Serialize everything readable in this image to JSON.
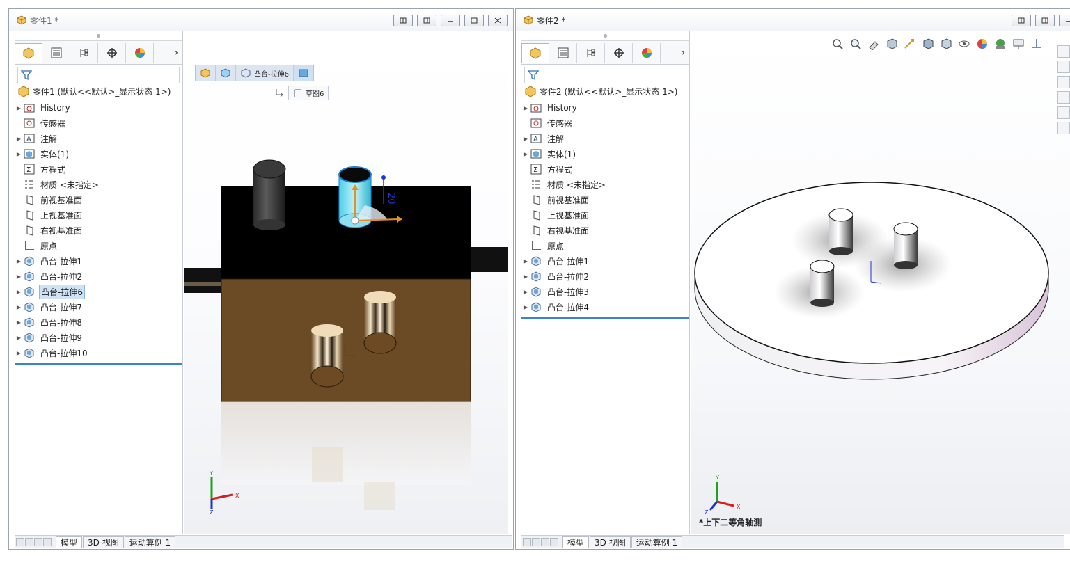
{
  "window1": {
    "title": "零件1 *",
    "breadcrumb": {
      "feature": "凸台-拉伸6",
      "sketch": "草图6"
    },
    "tree_root": "零件1  (默认<<默认>_显示状态 1>)",
    "tree": [
      {
        "label": "History",
        "icon": "history-folder-icon",
        "exp": true
      },
      {
        "label": "传感器",
        "icon": "sensor-icon",
        "exp": false
      },
      {
        "label": "注解",
        "icon": "annotation-icon",
        "exp": true
      },
      {
        "label": "实体(1)",
        "icon": "solid-body-icon",
        "exp": true
      },
      {
        "label": "方程式",
        "icon": "equation-icon",
        "exp": false
      },
      {
        "label": "材质 <未指定>",
        "icon": "material-icon",
        "exp": false
      },
      {
        "label": "前视基准面",
        "icon": "plane-icon",
        "exp": false
      },
      {
        "label": "上视基准面",
        "icon": "plane-icon",
        "exp": false
      },
      {
        "label": "右视基准面",
        "icon": "plane-icon",
        "exp": false
      },
      {
        "label": "原点",
        "icon": "origin-icon",
        "exp": false
      },
      {
        "label": "凸台-拉伸1",
        "icon": "extrude-icon",
        "exp": true
      },
      {
        "label": "凸台-拉伸2",
        "icon": "extrude-icon",
        "exp": true
      },
      {
        "label": "凸台-拉伸6",
        "icon": "extrude-icon",
        "exp": true,
        "selected": true
      },
      {
        "label": "凸台-拉伸7",
        "icon": "extrude-icon",
        "exp": true
      },
      {
        "label": "凸台-拉伸8",
        "icon": "extrude-icon",
        "exp": true
      },
      {
        "label": "凸台-拉伸9",
        "icon": "extrude-icon",
        "exp": true
      },
      {
        "label": "凸台-拉伸10",
        "icon": "extrude-icon",
        "exp": true
      }
    ],
    "dimension": "20",
    "bottom_tabs": [
      "模型",
      "3D 视图",
      "运动算例 1"
    ]
  },
  "window2": {
    "title": "零件2 *",
    "tree_root": "零件2  (默认<<默认>_显示状态 1>)",
    "tree": [
      {
        "label": "History",
        "icon": "history-folder-icon",
        "exp": true
      },
      {
        "label": "传感器",
        "icon": "sensor-icon",
        "exp": false
      },
      {
        "label": "注解",
        "icon": "annotation-icon",
        "exp": true
      },
      {
        "label": "实体(1)",
        "icon": "solid-body-icon",
        "exp": true
      },
      {
        "label": "方程式",
        "icon": "equation-icon",
        "exp": false
      },
      {
        "label": "材质 <未指定>",
        "icon": "material-icon",
        "exp": false
      },
      {
        "label": "前视基准面",
        "icon": "plane-icon",
        "exp": false
      },
      {
        "label": "上视基准面",
        "icon": "plane-icon",
        "exp": false
      },
      {
        "label": "右视基准面",
        "icon": "plane-icon",
        "exp": false
      },
      {
        "label": "原点",
        "icon": "origin-icon",
        "exp": false
      },
      {
        "label": "凸台-拉伸1",
        "icon": "extrude-icon",
        "exp": true
      },
      {
        "label": "凸台-拉伸2",
        "icon": "extrude-icon",
        "exp": true
      },
      {
        "label": "凸台-拉伸3",
        "icon": "extrude-icon",
        "exp": true
      },
      {
        "label": "凸台-拉伸4",
        "icon": "extrude-icon",
        "exp": true
      }
    ],
    "view_label": "*上下二等角轴测",
    "bottom_tabs": [
      "模型",
      "3D 视图",
      "运动算例 1"
    ]
  },
  "axes": {
    "x": "X",
    "y": "Y",
    "z": "Z"
  }
}
